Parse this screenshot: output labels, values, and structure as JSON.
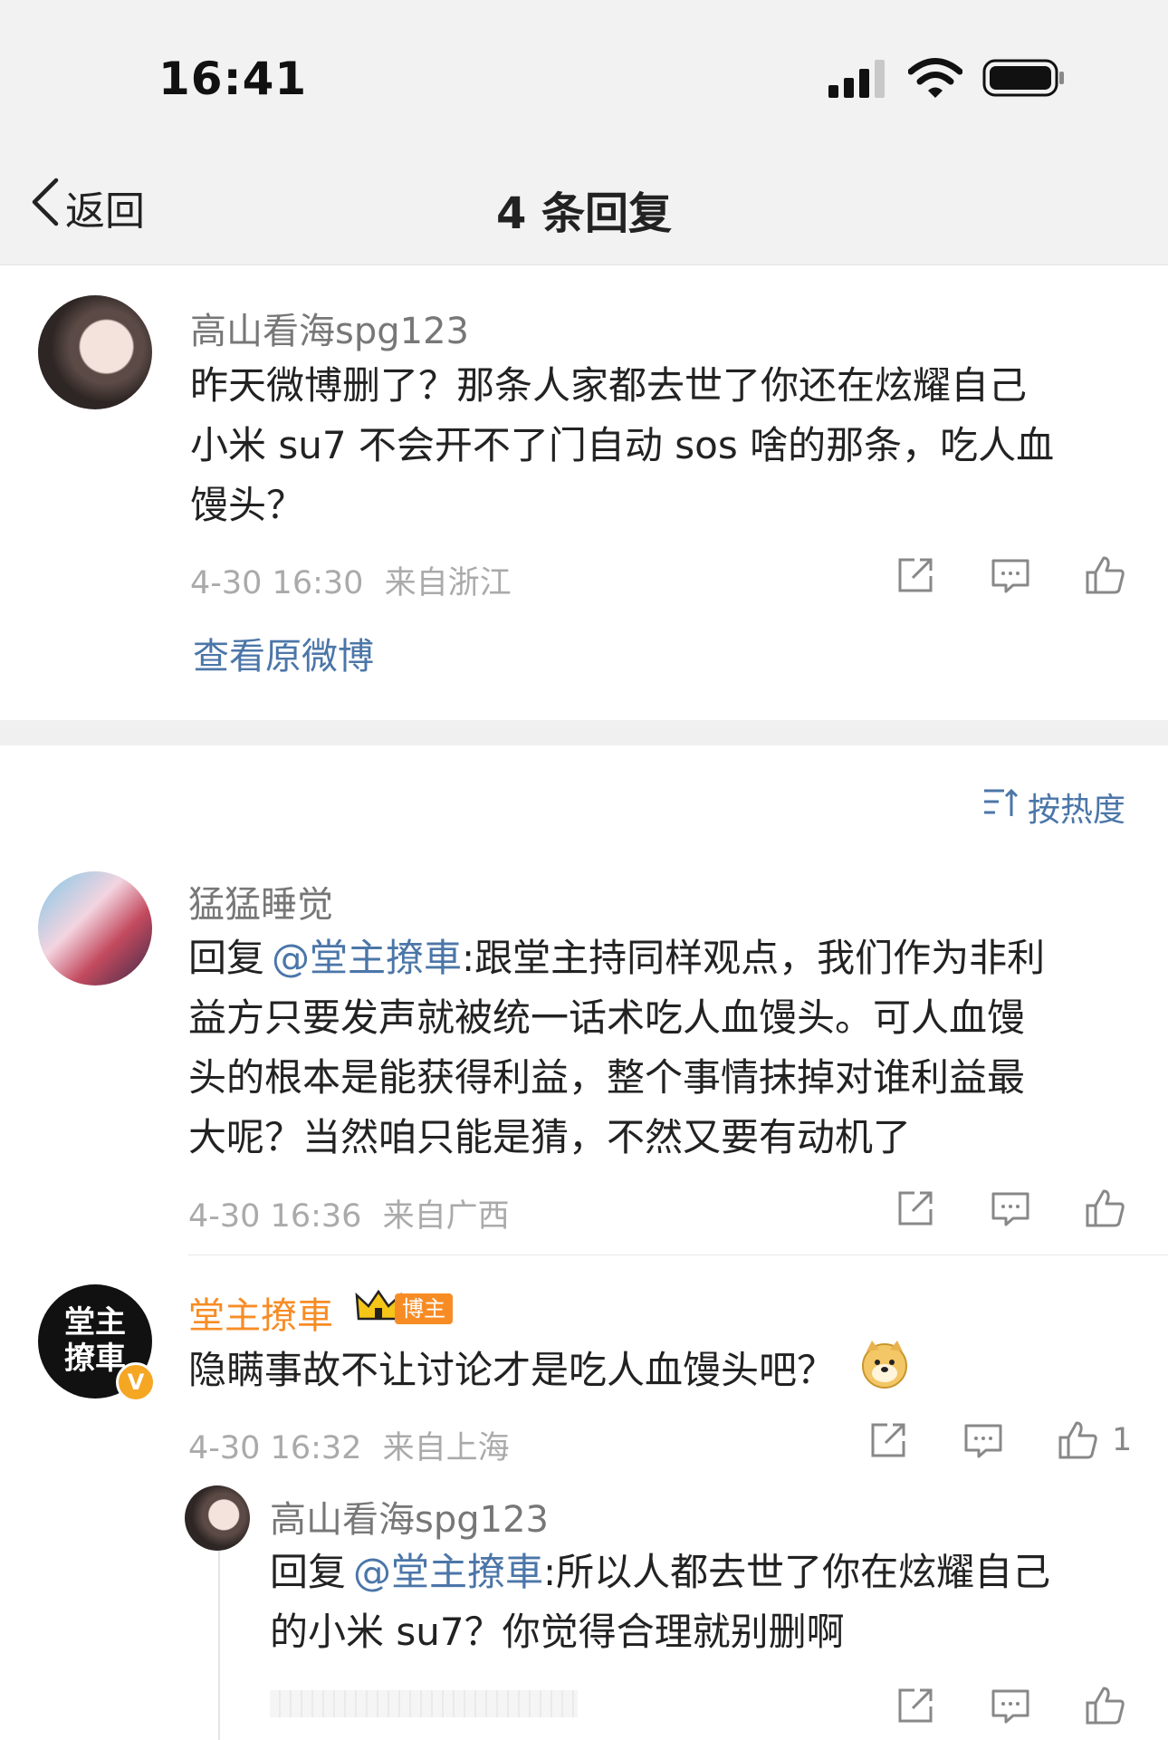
{
  "status_bar": {
    "time": "16:41"
  },
  "nav": {
    "back_label": "返回",
    "title": "4 条回复"
  },
  "main_comment": {
    "username": "高山看海spg123",
    "lines": [
      "昨天微博删了？那条人家都去世了你还在炫耀自己",
      "小米 su7 不会开不了门自动 sos 啥的那条，吃人血",
      "馒头？"
    ],
    "time": "4-30 16:30",
    "location": "来自浙江",
    "view_original": "查看原微博"
  },
  "sort": {
    "label": "按热度"
  },
  "replies": [
    {
      "username": "猛猛睡觉",
      "reply_prefix": "回复",
      "mention": "@堂主撩車",
      "lines": [
        ":跟堂主持同样观点，我们作为非利",
        "益方只要发声就被统一话术吃人血馒头。可人血馒",
        "头的根本是能获得利益，整个事情抹掉对谁利益最",
        "大呢？当然咱只能是猜，不然又要有动机了"
      ],
      "time": "4-30 16:36",
      "location": "来自广西"
    },
    {
      "username": "堂主撩車",
      "badge": "博主",
      "avatar_text": "堂主撩車",
      "text": "隐瞒事故不让讨论才是吃人血馒头吧？",
      "time": "4-30 16:32",
      "location": "来自上海",
      "like_count": "1"
    },
    {
      "username": "高山看海spg123",
      "reply_prefix": "回复",
      "mention": "@堂主撩車",
      "lines": [
        ":所以人都去世了你在炫耀自己",
        "的小米 su7？你觉得合理就别删啊"
      ]
    }
  ],
  "colors": {
    "link": "#4b76a8",
    "author": "#f78c25",
    "meta": "#aaaaaa"
  }
}
